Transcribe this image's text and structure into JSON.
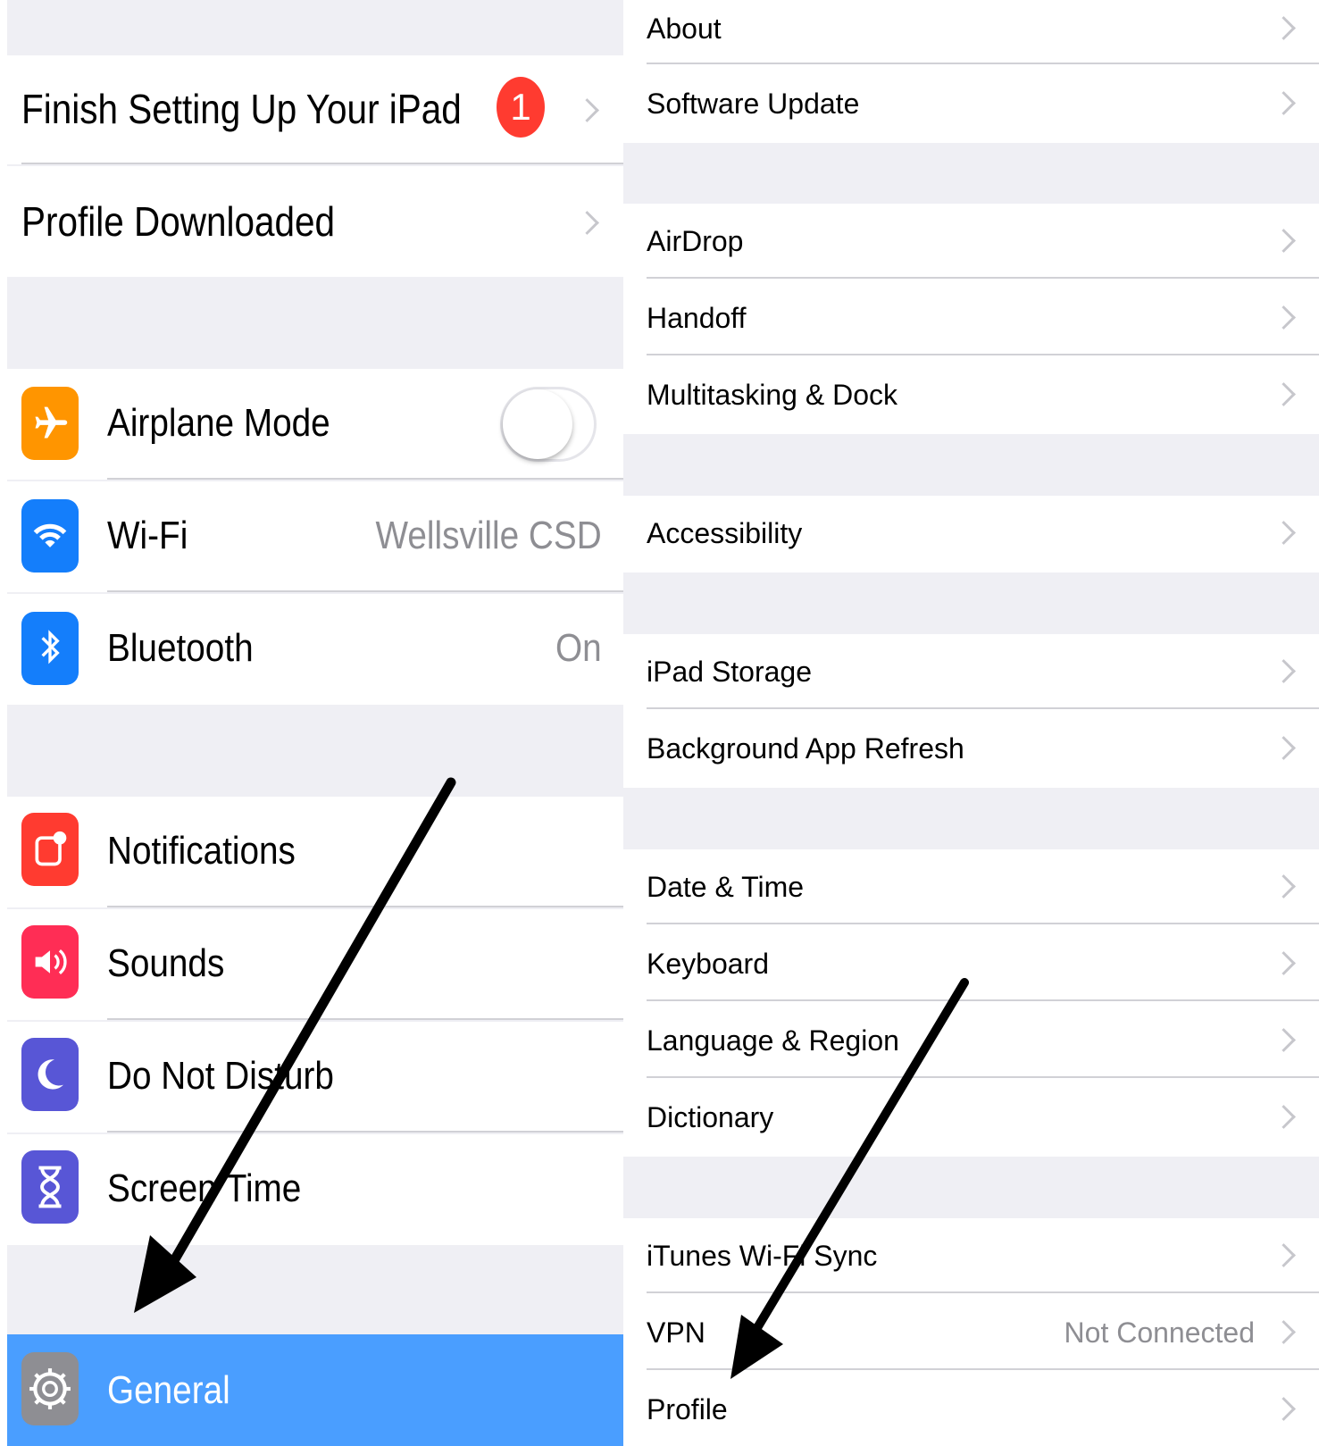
{
  "left": {
    "finish_setup": {
      "label": "Finish Setting Up Your iPad",
      "badge": "1"
    },
    "profile_downloaded": {
      "label": "Profile Downloaded"
    },
    "airplane_mode": {
      "label": "Airplane Mode",
      "icon": "airplane-icon",
      "color": "#ff9500",
      "toggle_on": false
    },
    "wifi": {
      "label": "Wi-Fi",
      "value": "Wellsville CSD",
      "icon": "wifi-icon",
      "color": "#147efb"
    },
    "bluetooth": {
      "label": "Bluetooth",
      "value": "On",
      "icon": "bluetooth-icon",
      "color": "#147efb"
    },
    "notifications": {
      "label": "Notifications",
      "icon": "notifications-icon",
      "color": "#ff3b30"
    },
    "sounds": {
      "label": "Sounds",
      "icon": "speaker-icon",
      "color": "#ff2d55"
    },
    "do_not_disturb": {
      "label": "Do Not Disturb",
      "icon": "moon-icon",
      "color": "#5856d6"
    },
    "screen_time": {
      "label": "Screen Time",
      "icon": "hourglass-icon",
      "color": "#5856d6"
    },
    "general": {
      "label": "General",
      "icon": "gear-icon",
      "selected_color": "#4a9eff"
    }
  },
  "right": {
    "items": [
      {
        "label": "About"
      },
      {
        "label": "Software Update"
      },
      {
        "label": "AirDrop"
      },
      {
        "label": "Handoff"
      },
      {
        "label": "Multitasking & Dock"
      },
      {
        "label": "Accessibility"
      },
      {
        "label": "iPad Storage"
      },
      {
        "label": "Background App Refresh"
      },
      {
        "label": "Date & Time"
      },
      {
        "label": "Keyboard"
      },
      {
        "label": "Language & Region"
      },
      {
        "label": "Dictionary"
      },
      {
        "label": "iTunes Wi-Fi Sync"
      },
      {
        "label": "VPN",
        "value": "Not Connected"
      },
      {
        "label": "Profile"
      }
    ]
  }
}
